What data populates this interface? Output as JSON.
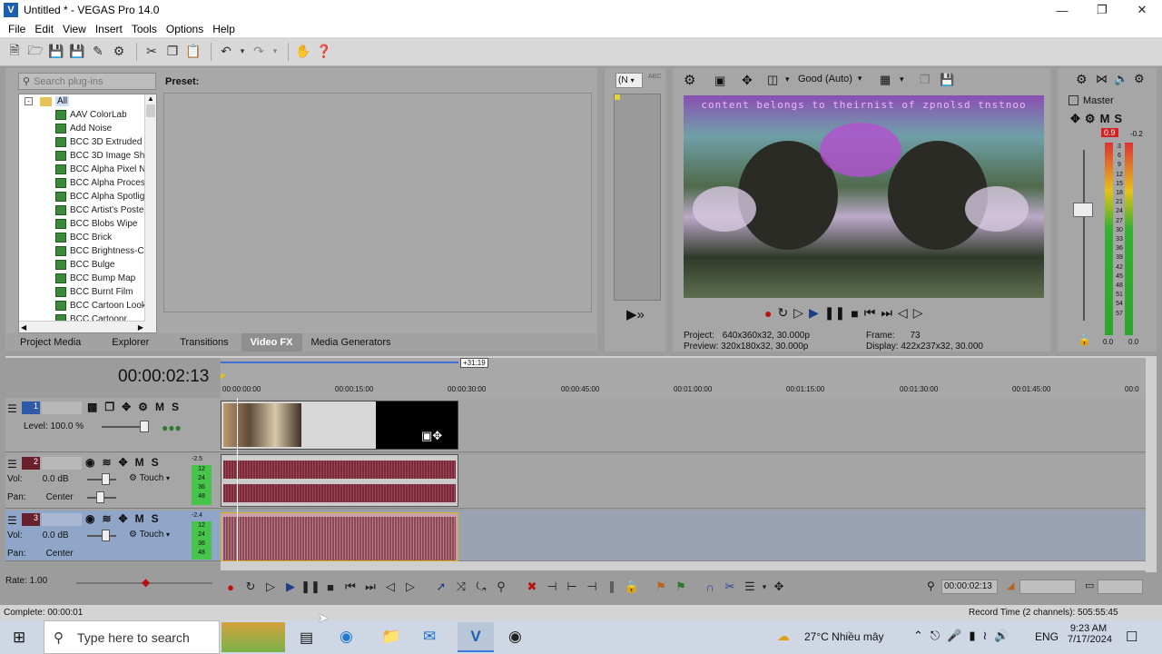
{
  "window": {
    "title": "Untitled * - VEGAS Pro 14.0",
    "app_icon_letter": "V"
  },
  "menu": [
    "File",
    "Edit",
    "View",
    "Insert",
    "Tools",
    "Options",
    "Help"
  ],
  "fx": {
    "search_placeholder": "Search plug-ins",
    "root_label": "All",
    "plugins": [
      "AAV ColorLab",
      "Add Noise",
      "BCC 3D Extruded",
      "BCC 3D Image Sha",
      "BCC Alpha Pixel N",
      "BCC Alpha Proces",
      "BCC Alpha Spotlig",
      "BCC Artist's Poste",
      "BCC Blobs Wipe",
      "BCC Brick",
      "BCC Brightness-C",
      "BCC Bulge",
      "BCC Bump Map",
      "BCC Burnt Film",
      "BCC Cartoon Look",
      "BCC Cartoonr"
    ],
    "preset_label": "Preset:"
  },
  "tabs": [
    "Project Media",
    "Explorer",
    "Transitions",
    "Video FX",
    "Media Generators"
  ],
  "active_tab": "Video FX",
  "trimmer": {
    "dropdown": "(N",
    "abc": "ABC"
  },
  "preview": {
    "quality": "Good (Auto)",
    "overlay_text": "content belongs to theirnist of zpnolsd tnstnoo",
    "project_label": "Project:",
    "project_value": "640x360x32, 30.000p",
    "preview_label": "Preview:",
    "preview_value": "320x180x32, 30.000p",
    "frame_label": "Frame:",
    "frame_value": "73",
    "display_label": "Display:",
    "display_value": "422x237x32, 30.000"
  },
  "master": {
    "label": "Master",
    "peak_left": "0.9",
    "peak_right": "-0.2",
    "scale": [
      "3",
      "6",
      "9",
      "12",
      "15",
      "18",
      "21",
      "24",
      "27",
      "30",
      "33",
      "36",
      "39",
      "42",
      "45",
      "48",
      "51",
      "54",
      "57"
    ],
    "bottom_left": "0.0",
    "bottom_right": "0.0"
  },
  "timeline": {
    "timecode": "00:00:02:13",
    "region_end": "+31:19",
    "ticks": [
      "00:00:00:00",
      "00:00:15:00",
      "00:00:30:00",
      "00:00:45:00",
      "00:01:00:00",
      "00:01:15:00",
      "00:01:30:00",
      "00:01:45:00",
      "00:0"
    ],
    "track1": {
      "number": "1",
      "level_label": "Level:",
      "level_value": "100.0 %"
    },
    "track2": {
      "number": "2",
      "vol_label": "Vol:",
      "vol_value": "0.0 dB",
      "pan_label": "Pan:",
      "pan_value": "Center",
      "mode": "Touch",
      "meter_top": "-2.5",
      "meter_scale": [
        "12",
        "24",
        "36",
        "48"
      ]
    },
    "track3": {
      "number": "3",
      "vol_label": "Vol:",
      "vol_value": "0.0 dB",
      "pan_label": "Pan:",
      "pan_value": "Center",
      "mode": "Touch",
      "meter_top": "-2.4",
      "meter_scale": [
        "12",
        "24",
        "36",
        "48"
      ]
    },
    "rate_label": "Rate: 1.00",
    "transport_timecode": "00:00:02:13"
  },
  "status": {
    "left": "Complete: 00:00:01",
    "right": "Record Time (2 channels): 505:55:45"
  },
  "taskbar": {
    "search_placeholder": "Type here to search",
    "weather": "27°C  Nhiều mây",
    "lang": "ENG",
    "time": "9:23 AM",
    "date": "7/17/2024"
  }
}
